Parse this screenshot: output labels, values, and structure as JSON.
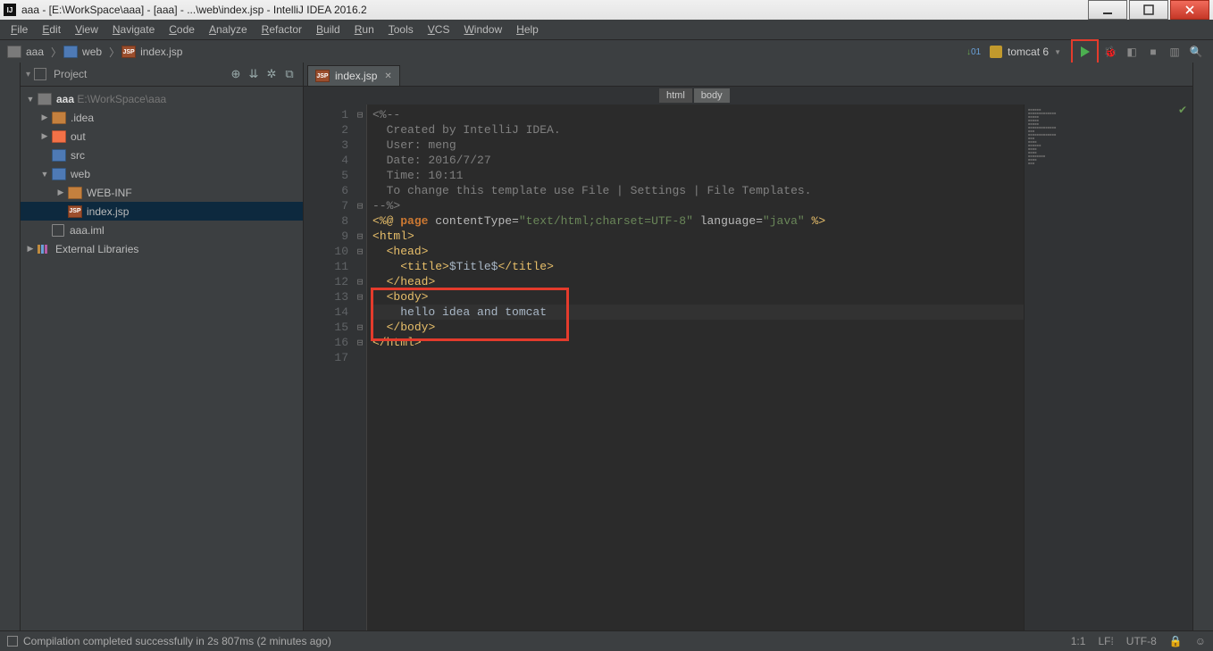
{
  "window": {
    "title": "aaa - [E:\\WorkSpace\\aaa] - [aaa] - ...\\web\\index.jsp - IntelliJ IDEA 2016.2"
  },
  "menu": [
    "File",
    "Edit",
    "View",
    "Navigate",
    "Code",
    "Analyze",
    "Refactor",
    "Build",
    "Run",
    "Tools",
    "VCS",
    "Window",
    "Help"
  ],
  "navcrumbs": {
    "a": "aaa",
    "b": "web",
    "c": "index.jsp"
  },
  "run_config": "tomcat 6",
  "project_panel_title": "Project",
  "tree": {
    "root": "aaa",
    "root_path": "E:\\WorkSpace\\aaa",
    "idea": ".idea",
    "out": "out",
    "src": "src",
    "web": "web",
    "webinf": "WEB-INF",
    "indexjsp": "index.jsp",
    "iml": "aaa.iml",
    "ext": "External Libraries"
  },
  "editor_tab": "index.jsp",
  "breadcrumb": {
    "a": "html",
    "b": "body"
  },
  "code": {
    "l1": "<%--",
    "l2": "  Created by IntelliJ IDEA.",
    "l3": "  User: meng",
    "l4": "  Date: 2016/7/27",
    "l5": "  Time: 10:11",
    "l6": "  To change this template use File | Settings | File Templates.",
    "l7": "--%>",
    "l8": {
      "a": "<%@ ",
      "b": "page ",
      "c": "contentType=",
      "d": "\"text/html;charset=UTF-8\"",
      "e": " language=",
      "f": "\"java\"",
      "g": " %>"
    },
    "l9": {
      "o": "<",
      "t": "html",
      "c": ">"
    },
    "l10": {
      "sp": "  ",
      "o": "<",
      "t": "head",
      "c": ">"
    },
    "l11": {
      "sp": "    ",
      "o": "<",
      "t": "title",
      "c": ">",
      "txt": "$Title$",
      "o2": "</",
      "c2": ">"
    },
    "l12": {
      "sp": "  ",
      "o": "</",
      "t": "head",
      "c": ">"
    },
    "l13": {
      "sp": "  ",
      "o": "<",
      "t": "body",
      "c": ">"
    },
    "l14": "    hello idea and tomcat",
    "l15": {
      "sp": "  ",
      "o": "</",
      "t": "body",
      "c": ">"
    },
    "l16": {
      "o": "</",
      "t": "html",
      "c": ">"
    }
  },
  "status": {
    "msg": "Compilation completed successfully in 2s 807ms (2 minutes ago)",
    "pos": "1:1",
    "le": "LF⁞",
    "enc": "UTF-8"
  }
}
